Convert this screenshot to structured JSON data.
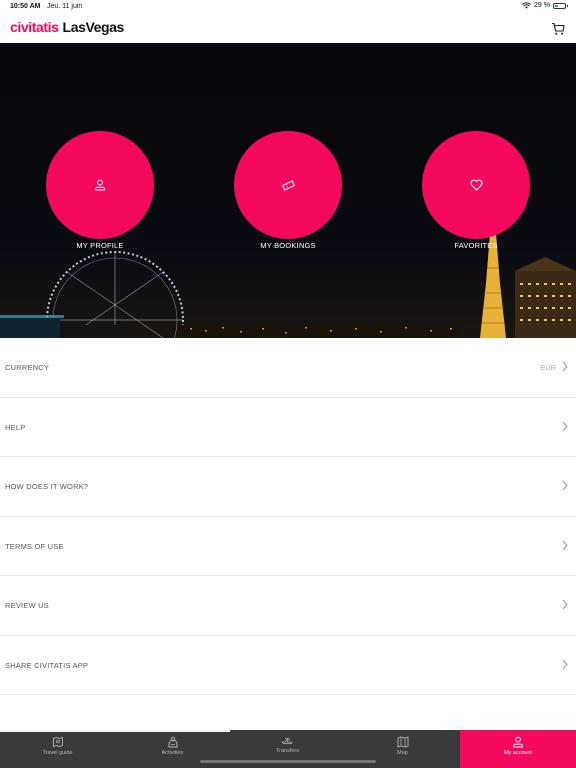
{
  "status_bar": {
    "time": "10:50 AM",
    "date": "Jeu. 11 juin",
    "battery": "29 %",
    "battery_level": 0.29
  },
  "header": {
    "brand": "civitatis",
    "city": "LasVegas",
    "cart_icon": "cart-icon"
  },
  "hero": {
    "buttons": [
      {
        "label": "MY PROFILE",
        "icon": "user-icon"
      },
      {
        "label": "MY BOOKINGS",
        "icon": "ticket-icon"
      },
      {
        "label": "FAVORITES",
        "icon": "heart-icon"
      }
    ]
  },
  "menu": {
    "items": [
      {
        "label": "CURRENCY",
        "value": "EUR"
      },
      {
        "label": "HELP",
        "value": ""
      },
      {
        "label": "HOW DOES IT WORK?",
        "value": ""
      },
      {
        "label": "TERMS OF USE",
        "value": ""
      },
      {
        "label": "REVIEW US",
        "value": ""
      },
      {
        "label": "SHARE CIVITATIS APP",
        "value": ""
      }
    ]
  },
  "tabs": [
    {
      "label": "Travel guide",
      "icon": "map-book-icon"
    },
    {
      "label": "Activities",
      "icon": "activities-icon"
    },
    {
      "label": "Transfers",
      "icon": "plane-icon"
    },
    {
      "label": "Map",
      "icon": "map-icon"
    },
    {
      "label": "My account",
      "icon": "user-icon",
      "active": true
    }
  ],
  "colors": {
    "brand": "#f4095f",
    "tab_bar": "#3a3a3c",
    "hero_bg": "#050509"
  }
}
